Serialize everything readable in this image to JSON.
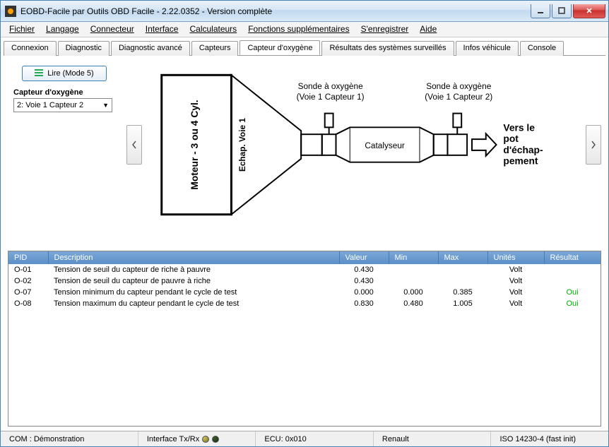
{
  "window": {
    "title": "EOBD-Facile par Outils OBD Facile - 2.22.0352 - Version complète"
  },
  "menu": {
    "items": [
      "Fichier",
      "Langage",
      "Connecteur",
      "Interface",
      "Calculateurs",
      "Fonctions supplémentaires",
      "S'enregistrer",
      "Aide"
    ]
  },
  "tabs": {
    "items": [
      "Connexion",
      "Diagnostic",
      "Diagnostic avancé",
      "Capteurs",
      "Capteur d'oxygène",
      "Résultats des systèmes surveillés",
      "Infos véhicule",
      "Console"
    ],
    "active_index": 4
  },
  "controls": {
    "read_label": "Lire (Mode 5)",
    "sensor_title": "Capteur d'oxygène",
    "sensor_select_value": "2: Voie 1 Capteur 2"
  },
  "diagram": {
    "engine_label": "Moteur - 3 ou 4 Cyl.",
    "exhaust_label": "Echap. Voie 1",
    "sensor1_title": "Sonde à oxygène",
    "sensor1_sub": "(Voie 1 Capteur 1)",
    "sensor2_title": "Sonde à oxygène",
    "sensor2_sub": "(Voie 1 Capteur 2)",
    "catalyst_label": "Catalyseur",
    "out_line1": "Vers le",
    "out_line2": "pot",
    "out_line3": "d'échap-",
    "out_line4": "pement"
  },
  "table": {
    "headers": {
      "pid": "PID",
      "desc": "Description",
      "val": "Valeur",
      "min": "Min",
      "max": "Max",
      "unit": "Unités",
      "res": "Résultat"
    },
    "rows": [
      {
        "pid": "O-01",
        "desc": "Tension de seuil du capteur de riche à pauvre",
        "val": "0.430",
        "min": "",
        "max": "",
        "unit": "Volt",
        "res": ""
      },
      {
        "pid": "O-02",
        "desc": "Tension de seuil du capteur de pauvre à riche",
        "val": "0.430",
        "min": "",
        "max": "",
        "unit": "Volt",
        "res": ""
      },
      {
        "pid": "O-07",
        "desc": "Tension minimum du capteur pendant le cycle de test",
        "val": "0.000",
        "min": "0.000",
        "max": "0.385",
        "unit": "Volt",
        "res": "Oui"
      },
      {
        "pid": "O-08",
        "desc": "Tension maximum du capteur pendant le cycle de test",
        "val": "0.830",
        "min": "0.480",
        "max": "1.005",
        "unit": "Volt",
        "res": "Oui"
      }
    ]
  },
  "statusbar": {
    "com": "COM : Démonstration",
    "iface": "Interface Tx/Rx",
    "ecu": "ECU: 0x010",
    "brand": "Renault",
    "proto": "ISO 14230-4 (fast init)"
  }
}
